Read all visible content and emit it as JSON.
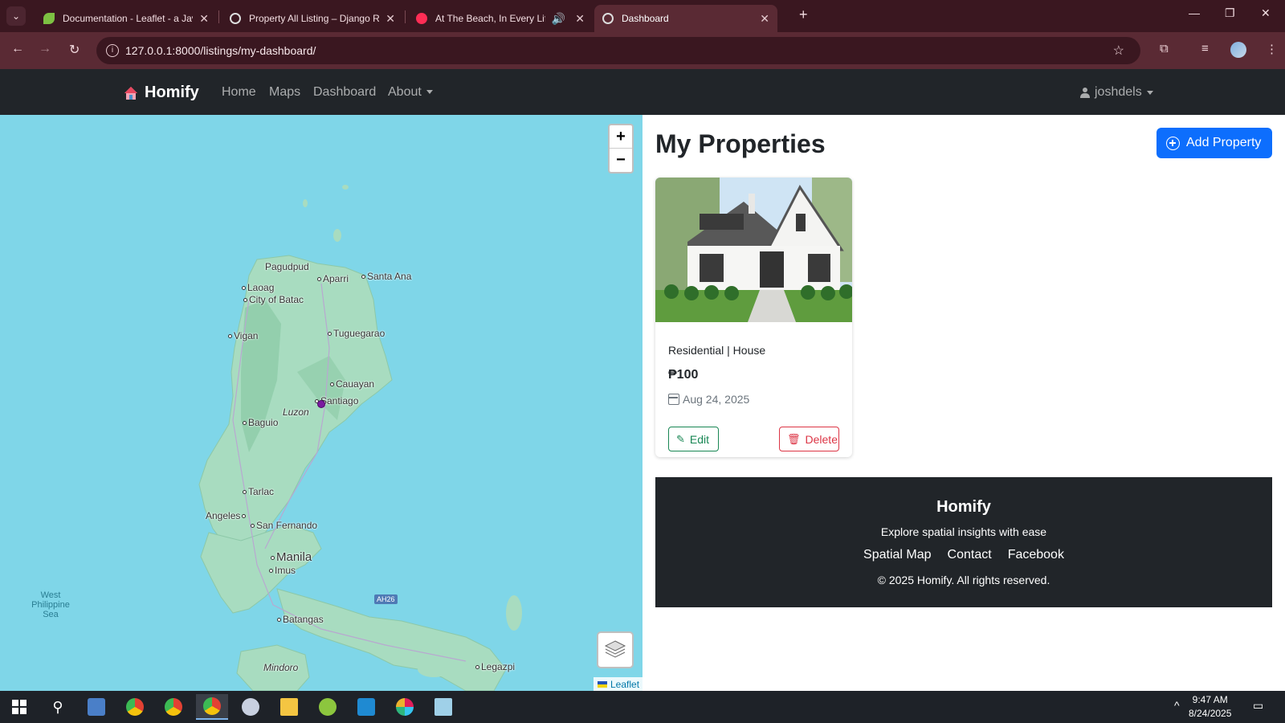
{
  "browser": {
    "tabs": [
      {
        "title": "Documentation - Leaflet - a JavaScript library",
        "active": false
      },
      {
        "title": "Property All Listing – Django REST framework",
        "active": false
      },
      {
        "title": "At The Beach, In Every Life - YouTube",
        "active": false
      },
      {
        "title": "Dashboard",
        "active": true
      }
    ],
    "url": "127.0.0.1:8000/listings/my-dashboard/"
  },
  "navbar": {
    "brand": "Homify",
    "links": [
      "Home",
      "Maps",
      "Dashboard",
      "About"
    ],
    "user": "joshdels"
  },
  "map": {
    "places": [
      "Pagudpud",
      "Aparri",
      "Santa Ana",
      "Laoag",
      "City of Batac",
      "Tuguegarao",
      "Vigan",
      "Cauayan",
      "Santiago",
      "Luzon",
      "Baguio",
      "Tarlac",
      "Angeles",
      "San Fernando",
      "Manila",
      "Imus",
      "Batangas",
      "Mindoro",
      "Legazpi"
    ],
    "sea": "West Philippine Sea",
    "road_shield": "AH26",
    "zoom_in": "+",
    "zoom_out": "−",
    "attribution": "Leaflet"
  },
  "main": {
    "title": "My Properties",
    "add_button": "Add Property",
    "cards": [
      {
        "type": "Residential | House",
        "price": "₱100",
        "date": "Aug 24, 2025",
        "edit": "Edit",
        "delete": "Delete"
      }
    ]
  },
  "footer": {
    "title": "Homify",
    "subtitle": "Explore spatial insights with ease",
    "links": [
      "Spatial Map",
      "Contact",
      "Facebook"
    ],
    "copyright": "© 2025 Homify. All rights reserved."
  },
  "taskbar": {
    "time": "9:47 AM",
    "date": "8/24/2025"
  },
  "colors": {
    "browser_tabbar": "#3a1720",
    "browser_toolbar": "#5a2a34",
    "navbar": "#212529",
    "primary": "#0d6efd",
    "success": "#198754",
    "danger": "#dc3545",
    "water": "#7fd6e8",
    "land": "#a8dcc0"
  }
}
